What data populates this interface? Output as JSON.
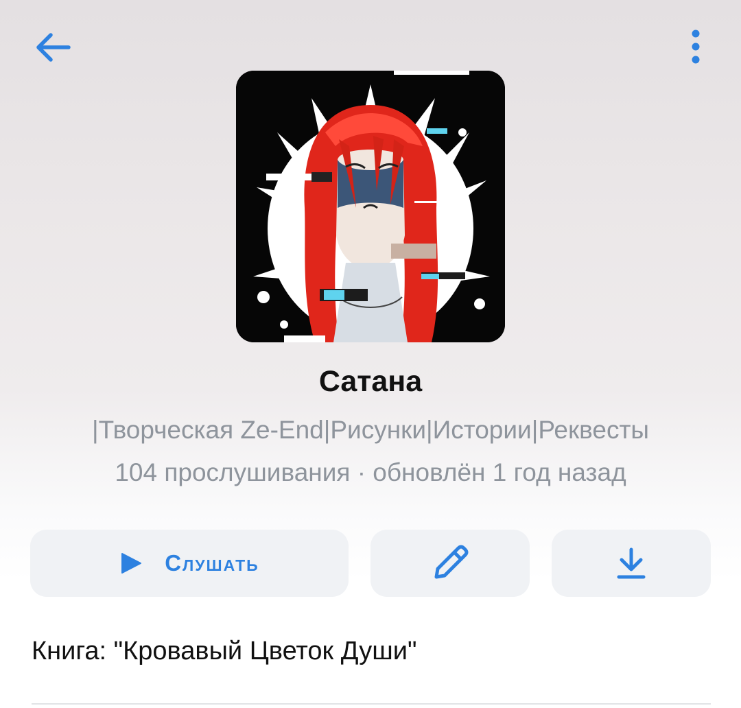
{
  "header": {
    "back_icon": "arrow-left-icon",
    "more_icon": "more-vertical-icon",
    "accent_color": "#2d81e0"
  },
  "playlist": {
    "title": "Сатана",
    "subtitle": "|Творческая Ze-End|Рисунки|Истории|Реквесты",
    "meta": "104 прослушивания · обновлён 1 год назад",
    "cover_icon": "anime-character-artwork"
  },
  "actions": {
    "listen_label": "Слушать",
    "listen_icon": "play-icon",
    "edit_icon": "pencil-icon",
    "download_icon": "download-icon"
  },
  "description": {
    "book": "Книга: \"Кровавый Цветок Души\""
  }
}
